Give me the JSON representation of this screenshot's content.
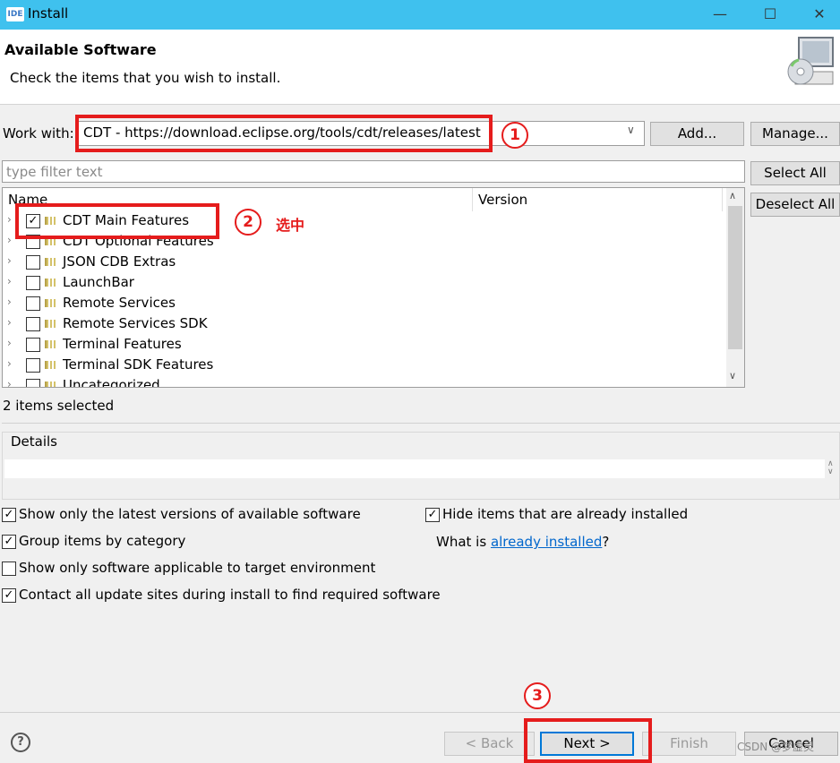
{
  "window": {
    "title": "Install",
    "app_icon": "IDE",
    "controls": {
      "minimize": "—",
      "maximize": "☐",
      "close": "✕"
    }
  },
  "header": {
    "title": "Available Software",
    "subtitle": "Check the items that you wish to install.",
    "banner_icon": "install-cd-monitor-icon"
  },
  "work_with": {
    "label": "Work with:",
    "value": "CDT - https://download.eclipse.org/tools/cdt/releases/latest",
    "add_label": "Add...",
    "manage_label": "Manage..."
  },
  "filter": {
    "placeholder": "type filter text",
    "select_all_label": "Select All",
    "deselect_all_label": "Deselect All"
  },
  "tree": {
    "columns": [
      "Name",
      "Version"
    ],
    "items": [
      {
        "label": "CDT Main Features",
        "checked": true
      },
      {
        "label": "CDT Optional Features",
        "checked": false
      },
      {
        "label": "JSON CDB Extras",
        "checked": false
      },
      {
        "label": "LaunchBar",
        "checked": false
      },
      {
        "label": "Remote Services",
        "checked": false
      },
      {
        "label": "Remote Services SDK",
        "checked": false
      },
      {
        "label": "Terminal Features",
        "checked": false
      },
      {
        "label": "Terminal SDK Features",
        "checked": false
      },
      {
        "label": "Uncategorized",
        "checked": false
      }
    ],
    "status": "2 items selected"
  },
  "details": {
    "label": "Details"
  },
  "options": {
    "latest_versions": {
      "label": "Show only the latest versions of available software",
      "checked": true
    },
    "hide_installed": {
      "label": "Hide items that are already installed",
      "checked": true
    },
    "group_by_category": {
      "label": "Group items by category",
      "checked": true
    },
    "target_env": {
      "label": "Show only software applicable to target environment",
      "checked": false
    },
    "contact_sites": {
      "label": "Contact all update sites during install to find required software",
      "checked": true
    },
    "what_is_prefix": "What is ",
    "what_is_link": "already installed",
    "what_is_suffix": "?"
  },
  "footer": {
    "help": "?",
    "back_label": "< Back",
    "next_label": "Next >",
    "finish_label": "Finish",
    "cancel_label": "Cancel"
  },
  "annotations": {
    "marker_1": "1",
    "marker_2": "2",
    "marker_3": "3",
    "selected_note": "选中",
    "color": "#e51c1c"
  },
  "watermark": "CSDN @梦虚灵"
}
